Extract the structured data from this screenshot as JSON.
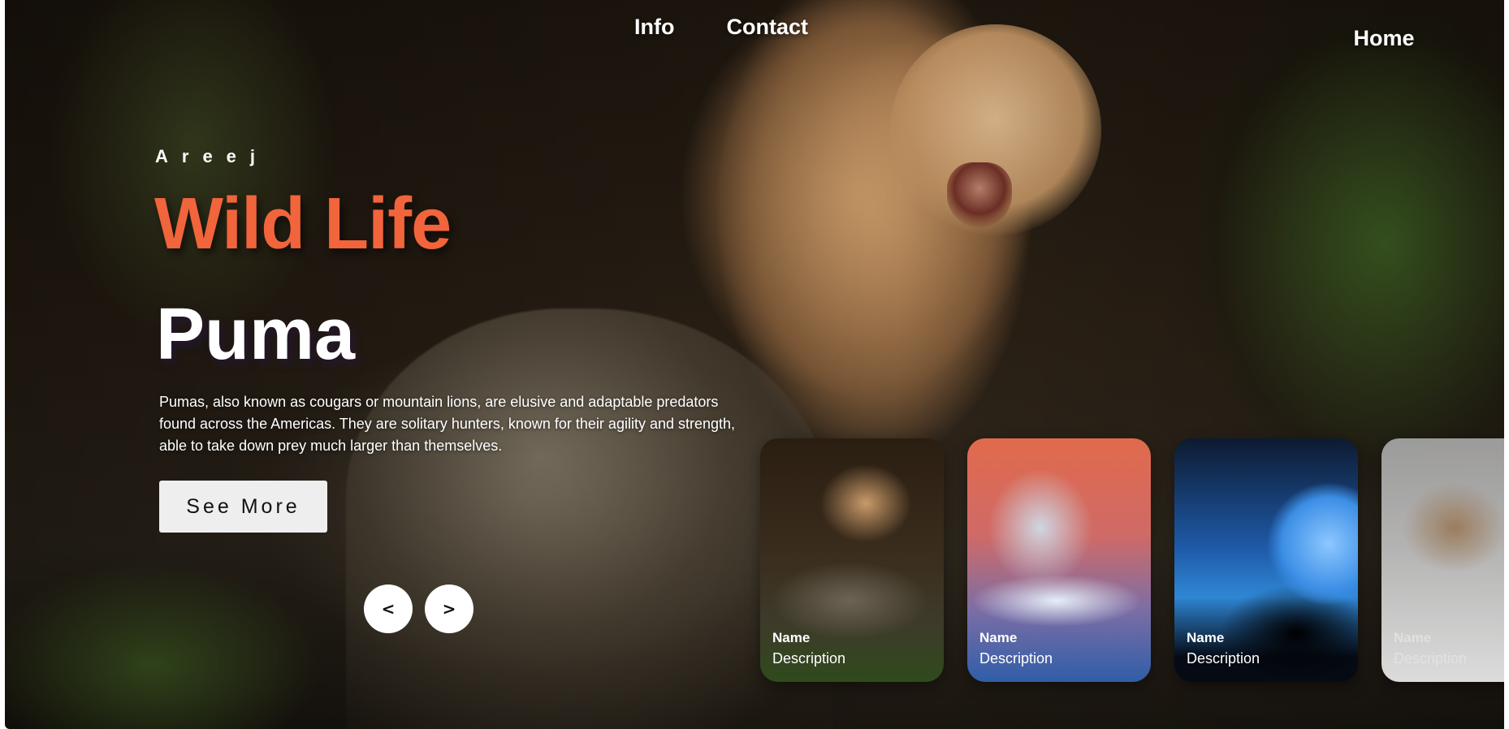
{
  "nav": {
    "home": "Home",
    "info": "Info",
    "contact": "Contact"
  },
  "hero": {
    "author": "Areej",
    "title": "Wild Life",
    "topic": "Puma",
    "description": "Pumas, also known as cougars or mountain lions, are elusive and adaptable predators found across the Americas. They are solitary hunters, known for their agility and strength, able to take down prey much larger than themselves.",
    "see_more": "See More",
    "title_color": "#f2643b"
  },
  "controls": {
    "prev_icon": "chevron-left-icon",
    "next_icon": "chevron-right-icon",
    "prev_glyph": "<",
    "next_glyph": ">"
  },
  "cards": [
    {
      "subject": "puma",
      "name": "Name",
      "description": "Description"
    },
    {
      "subject": "snow-leopard",
      "name": "Name",
      "description": "Description"
    },
    {
      "subject": "howling-wolf",
      "name": "Name",
      "description": "Description"
    },
    {
      "subject": "gray-wolf",
      "name": "Name",
      "description": "Description"
    }
  ]
}
